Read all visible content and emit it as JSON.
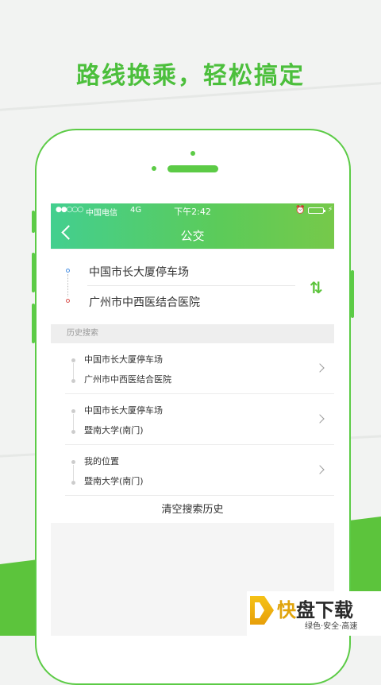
{
  "headline": "路线换乘，轻松搞定",
  "status_bar": {
    "signal": "●●○○○",
    "carrier": "中国电信",
    "network": "4G",
    "time": "下午2:42",
    "alarm": "⏰",
    "charging": "⚡"
  },
  "nav": {
    "title": "公交"
  },
  "route": {
    "from": "中国市长大厦停车场",
    "to": "广州市中西医结合医院",
    "swap_icon": "⇅"
  },
  "history": {
    "header": "历史搜索",
    "items": [
      {
        "from": "中国市长大厦停车场",
        "to": "广州市中西医结合医院"
      },
      {
        "from": "中国市长大厦停车场",
        "to": "暨南大学(南门)"
      },
      {
        "from": "我的位置",
        "to": "暨南大学(南门)"
      }
    ],
    "clear_label": "清空搜索历史"
  },
  "logo": {
    "char1": "快",
    "char2": "盘下载",
    "subtitle": "绿色·安全·高速"
  },
  "colors": {
    "brand_green": "#5cc43c",
    "accent_teal": "#43cf8f"
  }
}
